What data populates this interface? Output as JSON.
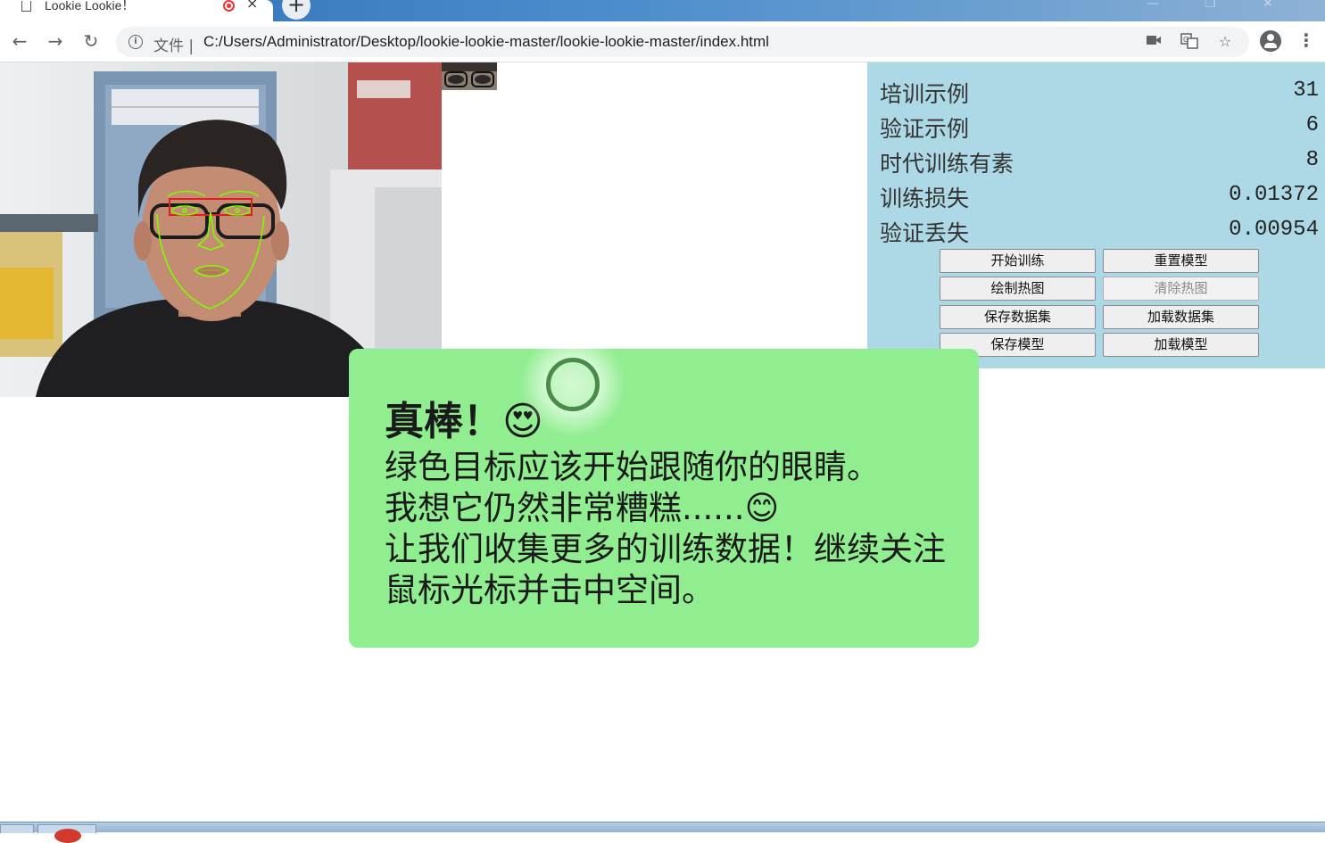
{
  "browser": {
    "tab_title": "Lookie Lookie！",
    "tab_close": "×",
    "new_tab": "+",
    "url_scheme": "文件 |",
    "url": "C:/Users/Administrator/Desktop/lookie-lookie-master/lookie-lookie-master/index.html"
  },
  "stats": [
    {
      "label": "培训示例",
      "value": "31"
    },
    {
      "label": "验证示例",
      "value": "6"
    },
    {
      "label": "时代训练有素",
      "value": "8"
    },
    {
      "label": "训练损失",
      "value": "0.01372"
    },
    {
      "label": "验证丢失",
      "value": "0.00954"
    }
  ],
  "buttons": {
    "start_training": "开始训练",
    "reset_model": "重置模型",
    "draw_heatmap": "绘制热图",
    "clear_heatmap": "清除热图",
    "save_dataset": "保存数据集",
    "load_dataset": "加载数据集",
    "save_model": "保存模型",
    "load_model": "加载模型"
  },
  "message": {
    "title": "真棒！😍",
    "line1": "绿色目标应该开始跟随你的眼睛。",
    "line2": "我想它仍然非常糟糕......😊",
    "line3": "让我们收集更多的训练数据！继续关注鼠标光标并击中空间。"
  },
  "colors": {
    "info_panel": "#add8e6",
    "message_card": "#90ee90",
    "target_ring": "#4a8a4a",
    "face_mesh": "#7cfc00",
    "eye_box": "#e02020"
  }
}
